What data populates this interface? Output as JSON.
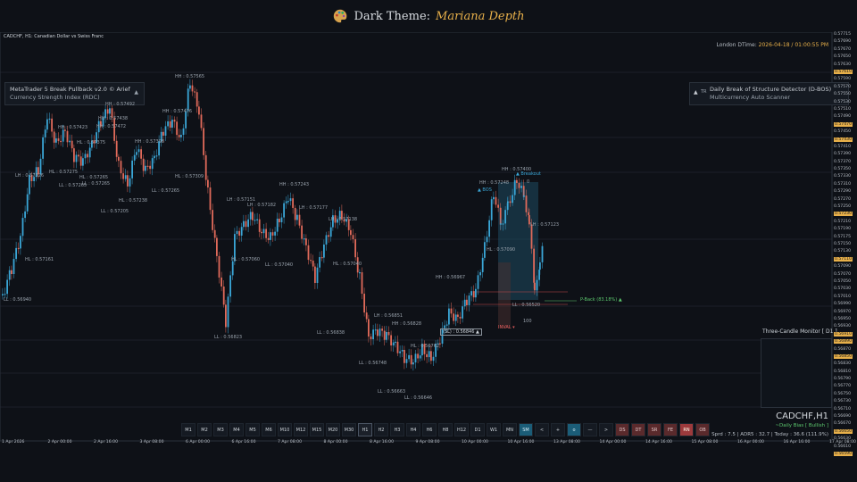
{
  "header": {
    "title_prefix": "Dark Theme:",
    "title_theme": "Mariana Depth",
    "icon": "palette-icon"
  },
  "symbol_line": "CADCHF, H1:  Canadian Dollar vs Swiss Franc",
  "clock": {
    "label": "London DTime:",
    "value": "2026-04-18 / 01:00:55 PM"
  },
  "panel_left": {
    "title": "MetaTrader 5  Break Pullback v2.0 © Arief",
    "subtitle": "Currency Strength Index (RDC)",
    "arrow": "▲"
  },
  "panel_right": {
    "badge": "TR",
    "title": "Daily Break of Structure Detector (D-BOS)",
    "subtitle": "Multicurrency Auto Scanner",
    "arrow": "▲"
  },
  "timeframes": [
    "M1",
    "M2",
    "M3",
    "M4",
    "M5",
    "M6",
    "M10",
    "M12",
    "M15",
    "M20",
    "M30",
    "H1",
    "H2",
    "H3",
    "H4",
    "H6",
    "H8",
    "H12",
    "D1",
    "W1",
    "MN"
  ],
  "active_timeframe": "H1",
  "tools": [
    {
      "label": "SM",
      "style": "blue"
    },
    {
      "label": "<",
      "style": "dark"
    },
    {
      "label": "+",
      "style": "dark"
    },
    {
      "label": "o",
      "style": "blue"
    },
    {
      "label": "—",
      "style": "dark"
    },
    {
      "label": ">",
      "style": "dark"
    },
    {
      "label": "DS",
      "style": "red"
    },
    {
      "label": "DT",
      "style": "red"
    },
    {
      "label": "SR",
      "style": "red"
    },
    {
      "label": "FE",
      "style": "red"
    },
    {
      "label": "RN",
      "style": "redact"
    },
    {
      "label": "OB",
      "style": "red"
    }
  ],
  "monitor": {
    "title": "Three-Candle Monitor [ D1 ]",
    "pair": "CADCHF,H1",
    "bias": "~Daily Bias [ Bullish ]",
    "stats": "Sprd : 7.5 | ADR5 : 32.7 | Today : 36.6 (111.9%)"
  },
  "x_axis": [
    "1 Apr 2026",
    "2 Apr 00:00",
    "2 Apr 16:00",
    "3 Apr 08:00",
    "6 Apr 00:00",
    "6 Apr 16:00",
    "7 Apr 08:00",
    "8 Apr 00:00",
    "8 Apr 16:00",
    "9 Apr 08:00",
    "10 Apr 00:00",
    "10 Apr 16:00",
    "13 Apr 08:00",
    "14 Apr 00:00",
    "14 Apr 16:00",
    "15 Apr 08:00",
    "16 Apr 00:00",
    "16 Apr 16:00",
    "17 Apr 08:00"
  ],
  "y_axis": [
    "0.57715",
    "0.57690",
    "0.57670",
    "0.57650",
    "0.57630",
    "0.57610",
    "0.57590",
    "0.57570",
    "0.57550",
    "0.57530",
    "0.57510",
    "0.57490",
    "0.57470",
    "0.57450",
    "0.57430",
    "0.57410",
    "0.57390",
    "0.57370",
    "0.57350",
    "0.57330",
    "0.57310",
    "0.57290",
    "0.57270",
    "0.57250",
    "0.57230",
    "0.57210",
    "0.57190",
    "0.57175",
    "0.57150",
    "0.57130",
    "0.57110",
    "0.57090",
    "0.57070",
    "0.57050",
    "0.57030",
    "0.57010",
    "0.56990",
    "0.56970",
    "0.56950",
    "0.56930",
    "0.56910",
    "0.56890",
    "0.56870",
    "0.56850",
    "0.56830",
    "0.56810",
    "0.56790",
    "0.56770",
    "0.56750",
    "0.56730",
    "0.56710",
    "0.56690",
    "0.56670",
    "0.56650",
    "0.56630",
    "0.56610",
    "0.56590"
  ],
  "y_axis_highlights": [
    "0.57610",
    "0.57470",
    "0.57430",
    "0.57230",
    "0.57110",
    "0.56910",
    "0.56890",
    "0.56850",
    "0.56650",
    "0.56590"
  ],
  "swing_labels": [
    {
      "text": "LL : 0.56940",
      "tone": "lg"
    },
    {
      "text": "HL : 0.57161",
      "tone": "lg"
    },
    {
      "text": "LH : 0.57326",
      "tone": "lg"
    },
    {
      "text": "HL : 0.57275",
      "tone": "lg"
    },
    {
      "text": "LL : 0.57265",
      "tone": "lg"
    },
    {
      "text": "HH : 0.57423",
      "tone": "lg"
    },
    {
      "text": "HL : 0.57375",
      "tone": "lg"
    },
    {
      "text": "HL : 0.57265",
      "tone": "lg"
    },
    {
      "text": "LL : 0.57265",
      "tone": "lg"
    },
    {
      "text": "HH : 0.57438",
      "tone": "lg"
    },
    {
      "text": "HH : 0.57472",
      "tone": "lg"
    },
    {
      "text": "HH : 0.57492",
      "tone": "lg"
    },
    {
      "text": "LL : 0.57205",
      "tone": "lg"
    },
    {
      "text": "HL : 0.57238",
      "tone": "lg"
    },
    {
      "text": "HH : 0.57398",
      "tone": "lg"
    },
    {
      "text": "LL : 0.57265",
      "tone": "lg"
    },
    {
      "text": "HL : 0.57309",
      "tone": "lg"
    },
    {
      "text": "HH : 0.57565",
      "tone": "lg"
    },
    {
      "text": "HH : 0.57476",
      "tone": "lg"
    },
    {
      "text": "LH : 0.57151",
      "tone": "lg"
    },
    {
      "text": "LH : 0.57182",
      "tone": "lg"
    },
    {
      "text": "HL : 0.57060",
      "tone": "lg"
    },
    {
      "text": "LL : 0.57040",
      "tone": "lg"
    },
    {
      "text": "HH : 0.57243",
      "tone": "lg"
    },
    {
      "text": "LL : 0.56823",
      "tone": "lg"
    },
    {
      "text": "LH : 0.57177",
      "tone": "lg"
    },
    {
      "text": "LH : 0.57138",
      "tone": "lg"
    },
    {
      "text": "HL : 0.57040",
      "tone": "lg"
    },
    {
      "text": "LL : 0.56838",
      "tone": "lg"
    },
    {
      "text": "LH : 0.56851",
      "tone": "lg"
    },
    {
      "text": "HH : 0.56828",
      "tone": "lg"
    },
    {
      "text": "LL : 0.56748",
      "tone": "lg"
    },
    {
      "text": "HL : 0.56762",
      "tone": "lg"
    },
    {
      "text": "LL : 0.56663",
      "tone": "lg"
    },
    {
      "text": "LL : 0.56646",
      "tone": "lg"
    },
    {
      "text": "HH : 0.56967",
      "tone": "lg"
    },
    {
      "text": "HH : 0.57248",
      "tone": "lg"
    },
    {
      "text": "HH : 0.57400",
      "tone": "lg"
    },
    {
      "text": "HL : 0.57090",
      "tone": "lg"
    },
    {
      "text": "LH : 0.57123",
      "tone": "lg"
    },
    {
      "text": "LL : 0.56520",
      "tone": "lg"
    }
  ],
  "markers": {
    "bos": "▲ BOS",
    "breakout": "▲ Breakout",
    "sl": "(SL) : 0.56846 ▲",
    "inval": "INVAL ▾",
    "pback": "P-Back (83.18%) ▲",
    "hundred": "100",
    "zero": "0"
  }
}
